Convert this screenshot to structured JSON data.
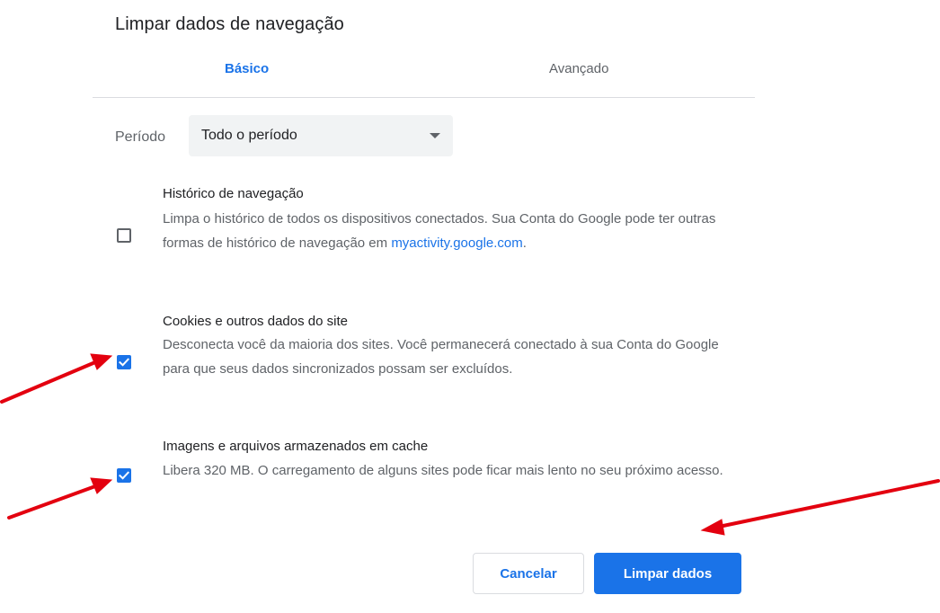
{
  "dialog": {
    "title": "Limpar dados de navegação",
    "tabs": [
      {
        "label": "Básico",
        "active": true
      },
      {
        "label": "Avançado",
        "active": false
      }
    ],
    "period": {
      "label": "Período",
      "selected": "Todo o período"
    },
    "options": [
      {
        "title": "Histórico de navegação",
        "description": "Limpa o histórico de todos os dispositivos conectados. Sua Conta do Google pode ter outras formas de histórico de navegação em",
        "link": "myactivity.google.com",
        "link_suffix": ".",
        "checked": false
      },
      {
        "title": "Cookies e outros dados do site",
        "description": "Desconecta você da maioria dos sites. Você permanecerá conectado à sua Conta do Google para que seus dados sincronizados possam ser excluídos.",
        "checked": true
      },
      {
        "title": "Imagens e arquivos armazenados em cache",
        "description": "Libera 320 MB. O carregamento de alguns sites pode ficar mais lento no seu próximo acesso.",
        "checked": true
      }
    ],
    "buttons": {
      "cancel": "Cancelar",
      "confirm": "Limpar dados"
    }
  },
  "colors": {
    "accent": "#1a73e8",
    "annotation_arrow": "#e3000f",
    "text_primary": "#202124",
    "text_secondary": "#5f6368"
  }
}
